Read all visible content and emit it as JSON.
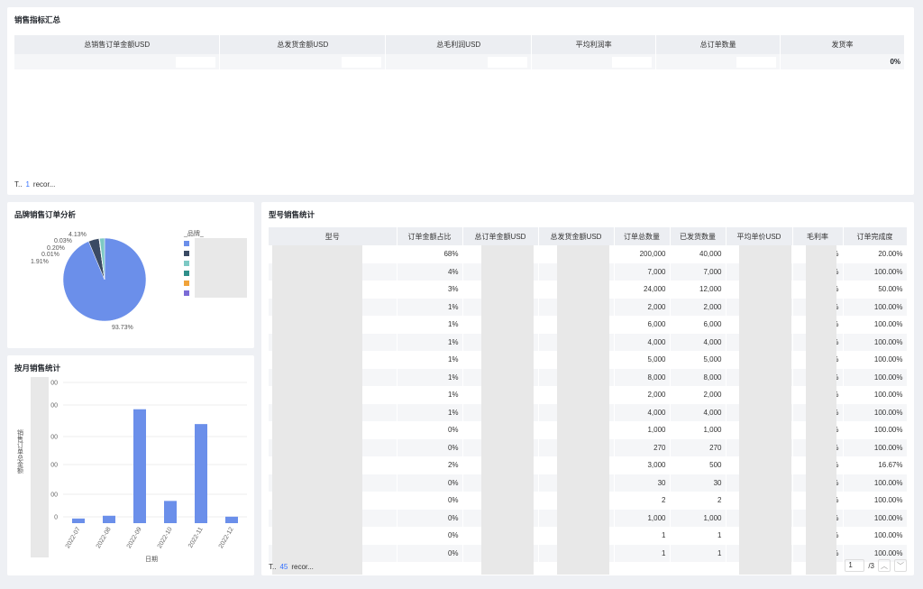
{
  "summary": {
    "title": "销售指标汇总",
    "columns": [
      "总销售订单金额USD",
      "总发货金额USD",
      "总毛利润USD",
      "平均利润率",
      "总订单数量",
      "发货率"
    ],
    "values": [
      "",
      "",
      "",
      "",
      "",
      "0%"
    ],
    "footer": {
      "prefix": "T..",
      "count": "1",
      "suffix": "recor..."
    }
  },
  "pie": {
    "title": "品牌销售订单分析",
    "legend_title": "_品牌_",
    "legend_colors": [
      "#6b8fea",
      "#3a4a63",
      "#7dc9c4",
      "#2f8f8a",
      "#f0a33a",
      "#7b6bd6"
    ]
  },
  "bar": {
    "title": "按月销售统计",
    "xlabel": "日期",
    "ylabel": "销售订单总金额"
  },
  "model": {
    "title": "型号销售统计",
    "columns": [
      "型号",
      "订单金额占比",
      "总订单金额USD",
      "总发货金额USD",
      "订单总数量",
      "已发货数量",
      "平均单价USD",
      "毛利率",
      "订单完成度"
    ],
    "rows": [
      {
        "share": "68%",
        "qty": "200,000",
        "shipped": "40,000",
        "margin": "%",
        "completion": "20.00%"
      },
      {
        "share": "4%",
        "qty": "7,000",
        "shipped": "7,000",
        "margin": "%",
        "completion": "100.00%"
      },
      {
        "share": "3%",
        "qty": "24,000",
        "shipped": "12,000",
        "margin": "%",
        "completion": "50.00%"
      },
      {
        "share": "1%",
        "qty": "2,000",
        "shipped": "2,000",
        "margin": "%",
        "completion": "100.00%"
      },
      {
        "share": "1%",
        "qty": "6,000",
        "shipped": "6,000",
        "margin": "%",
        "completion": "100.00%"
      },
      {
        "share": "1%",
        "qty": "4,000",
        "shipped": "4,000",
        "margin": "%",
        "completion": "100.00%"
      },
      {
        "share": "1%",
        "qty": "5,000",
        "shipped": "5,000",
        "margin": "%",
        "completion": "100.00%"
      },
      {
        "share": "1%",
        "qty": "8,000",
        "shipped": "8,000",
        "margin": "%",
        "completion": "100.00%"
      },
      {
        "share": "1%",
        "qty": "2,000",
        "shipped": "2,000",
        "margin": "%",
        "completion": "100.00%"
      },
      {
        "share": "1%",
        "qty": "4,000",
        "shipped": "4,000",
        "margin": "%",
        "completion": "100.00%"
      },
      {
        "share": "0%",
        "qty": "1,000",
        "shipped": "1,000",
        "margin": "%",
        "completion": "100.00%"
      },
      {
        "share": "0%",
        "qty": "270",
        "shipped": "270",
        "margin": "%",
        "completion": "100.00%"
      },
      {
        "share": "2%",
        "qty": "3,000",
        "shipped": "500",
        "margin": "%",
        "completion": "16.67%"
      },
      {
        "share": "0%",
        "qty": "30",
        "shipped": "30",
        "margin": "%",
        "completion": "100.00%"
      },
      {
        "share": "0%",
        "qty": "2",
        "shipped": "2",
        "margin": "%",
        "completion": "100.00%"
      },
      {
        "share": "0%",
        "qty": "1,000",
        "shipped": "1,000",
        "margin": "%",
        "completion": "100.00%"
      },
      {
        "share": "0%",
        "qty": "1",
        "shipped": "1",
        "margin": "%",
        "completion": "100.00%"
      },
      {
        "share": "0%",
        "qty": "1",
        "shipped": "1",
        "margin": "%",
        "completion": "100.00%"
      }
    ],
    "footer": {
      "prefix": "T..",
      "count": "45",
      "suffix": "recor..."
    },
    "pager": {
      "page": "1",
      "total": "/3"
    }
  },
  "chart_data": [
    {
      "type": "pie",
      "title": "品牌销售订单分析",
      "slices": [
        {
          "label": "93.73%",
          "value": 93.73,
          "color": "#6b8fea"
        },
        {
          "label": "4.13%",
          "value": 4.13,
          "color": "#3a4a63"
        },
        {
          "label": "0.03%",
          "value": 0.03,
          "color": "#7dc9c4"
        },
        {
          "label": "0.20%",
          "value": 0.2,
          "color": "#2f8f8a"
        },
        {
          "label": "0.01%",
          "value": 0.01,
          "color": "#f0a33a"
        },
        {
          "label": "1.91%",
          "value": 1.91,
          "color": "#7dc9c4"
        }
      ]
    },
    {
      "type": "bar",
      "title": "按月销售统计",
      "xlabel": "日期",
      "ylabel": "销售订单总金额",
      "categories": [
        "2022-07",
        "2022-08",
        "2022-09",
        "2022-10",
        "2022-11",
        "2022-12"
      ],
      "values": [
        5,
        8,
        123,
        24,
        107,
        7
      ],
      "ytick_labels": [
        "00",
        "00",
        "00",
        "00",
        "00",
        "0"
      ],
      "ylim": [
        0,
        150
      ],
      "color": "#6b8fea"
    }
  ]
}
